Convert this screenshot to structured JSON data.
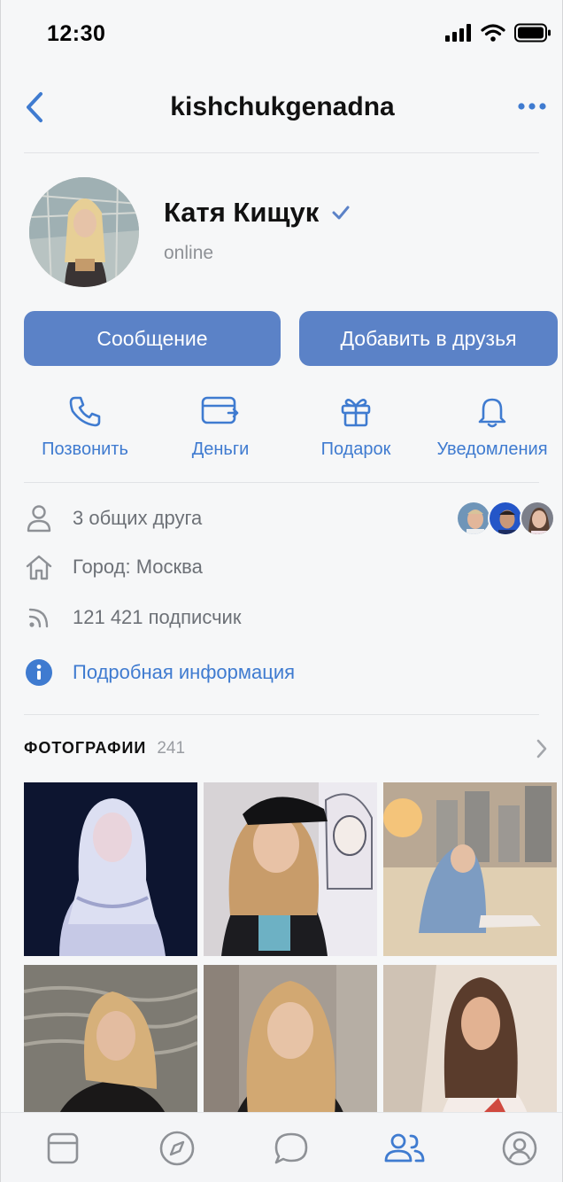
{
  "status_bar": {
    "time": "12:30",
    "icons": [
      "signal-icon",
      "wifi-icon",
      "battery-icon"
    ]
  },
  "nav": {
    "title": "kishchukgenadna",
    "back_icon": "chevron-left-icon",
    "more_icon": "more-dots-icon"
  },
  "profile": {
    "name": "Катя Кищук",
    "verified_icon": "checkmark-icon",
    "status": "online"
  },
  "buttons": {
    "message": "Сообщение",
    "add_friend": "Добавить в друзья"
  },
  "actions": [
    {
      "label": "Позвонить",
      "icon": "phone-icon"
    },
    {
      "label": "Деньги",
      "icon": "money-card-icon"
    },
    {
      "label": "Подарок",
      "icon": "gift-icon"
    },
    {
      "label": "Уведомления",
      "icon": "bell-icon"
    }
  ],
  "info": {
    "mutual_friends": "3 общих друга",
    "city": "Город: Москва",
    "followers": "121 421 подписчик",
    "details_link": "Подробная информация"
  },
  "photos": {
    "title": "ФОТОГРАФИИ",
    "count": "241"
  },
  "tab_bar": {
    "tabs": [
      "feed-icon",
      "explore-compass-icon",
      "messages-icon",
      "friends-icon",
      "profile-icon"
    ],
    "active": "friends-icon"
  },
  "colors": {
    "accent": "#3f7bd0",
    "button": "#5b82c7",
    "background": "#f6f7f8",
    "secondary_text": "#6d7177"
  }
}
